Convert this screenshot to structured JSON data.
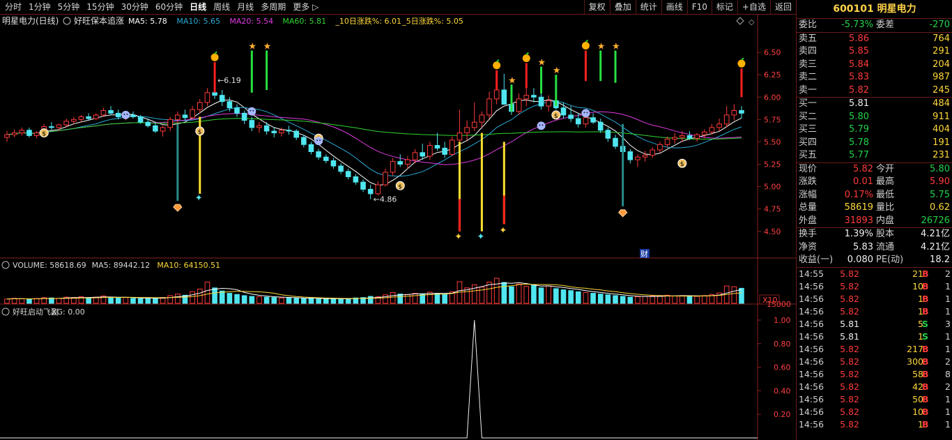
{
  "toolbar": {
    "periods": [
      "分时",
      "1分钟",
      "5分钟",
      "15分钟",
      "30分钟",
      "60分钟",
      "日线",
      "周线",
      "月线",
      "多周期",
      "更多"
    ],
    "active_period": "日线",
    "tools": [
      "复权",
      "叠加",
      "统计",
      "画线",
      "F10",
      "标记",
      "+自选",
      "返回"
    ]
  },
  "main_panel": {
    "stock_label": "明星电力(日线)",
    "indicator_name": "好旺保本追涨",
    "legend": [
      {
        "text": "MA5: 5.78",
        "color": "#ffffff"
      },
      {
        "text": "MA10: 5.65",
        "color": "#2aa9d6"
      },
      {
        "text": "MA20: 5.54",
        "color": "#e03be0"
      },
      {
        "text": "MA60: 5.81",
        "color": "#31d631"
      },
      {
        "text": "_10日涨跌%: 6.01",
        "color": "#ffd83a"
      },
      {
        "text": "_5日涨跌%: 5.05",
        "color": "#ffd83a"
      }
    ],
    "high_label": "6.19",
    "low_label": "4.86",
    "cai_label": "财",
    "y_ticks": [
      "6.50",
      "6.25",
      "6.00",
      "5.75",
      "5.50",
      "5.25",
      "5.00",
      "4.75",
      "4.50"
    ]
  },
  "volume_panel": {
    "legend": [
      {
        "text": "VOLUME: 58618.69",
        "color": "#d8d8d8"
      },
      {
        "text": "MA5: 89442.12",
        "color": "#d8d8d8"
      },
      {
        "text": "MA10: 64150.51",
        "color": "#ffd83a"
      }
    ],
    "y_tick": "15000",
    "unit": "X10"
  },
  "xg_panel": {
    "legend": [
      {
        "text": "好旺启动飞副",
        "color": "#d8d8d8"
      },
      {
        "text": "XG: 0.00",
        "color": "#d8d8d8"
      }
    ],
    "y_ticks": [
      "1.00",
      "0.80",
      "0.60",
      "0.40",
      "0.20"
    ]
  },
  "quote": {
    "header": "600101 明星电力",
    "weibi_label": "委比",
    "weibi": "-5.73%",
    "weicha_label": "委差",
    "weicha": "-270",
    "asks": [
      {
        "label": "卖五",
        "price": "5.86",
        "vol": "764"
      },
      {
        "label": "卖四",
        "price": "5.85",
        "vol": "291"
      },
      {
        "label": "卖三",
        "price": "5.84",
        "vol": "204"
      },
      {
        "label": "卖二",
        "price": "5.83",
        "vol": "987"
      },
      {
        "label": "卖一",
        "price": "5.82",
        "vol": "245"
      }
    ],
    "bids": [
      {
        "label": "买一",
        "price": "5.81",
        "vol": "484"
      },
      {
        "label": "买二",
        "price": "5.80",
        "vol": "911"
      },
      {
        "label": "买三",
        "price": "5.79",
        "vol": "404"
      },
      {
        "label": "买四",
        "price": "5.78",
        "vol": "191"
      },
      {
        "label": "买五",
        "price": "5.77",
        "vol": "231"
      }
    ],
    "stats": [
      {
        "l1": "现价",
        "v1": "5.82",
        "c1": "red",
        "l2": "今开",
        "v2": "5.80",
        "c2": "green"
      },
      {
        "l1": "涨跌",
        "v1": "0.01",
        "c1": "red",
        "l2": "最高",
        "v2": "5.90",
        "c2": "red"
      },
      {
        "l1": "涨幅",
        "v1": "0.17%",
        "c1": "red",
        "l2": "最低",
        "v2": "5.75",
        "c2": "green"
      },
      {
        "l1": "总量",
        "v1": "58619",
        "c1": "yellow",
        "l2": "量比",
        "v2": "0.62",
        "c2": "yellow"
      },
      {
        "l1": "外盘",
        "v1": "31893",
        "c1": "red",
        "l2": "内盘",
        "v2": "26726",
        "c2": "green"
      }
    ],
    "extra": [
      {
        "l1": "换手",
        "v1": "1.39%",
        "l2": "股本",
        "v2": "4.21亿"
      },
      {
        "l1": "净资",
        "v1": "5.83",
        "l2": "流通",
        "v2": "4.21亿"
      },
      {
        "l1": "收益(一)",
        "v1": "0.080",
        "l2": "PE(动)",
        "v2": "18.2"
      }
    ],
    "ticks": [
      {
        "time": "14:55",
        "price": "5.82",
        "vol": "21",
        "bs": "B",
        "n": "2"
      },
      {
        "time": "14:56",
        "price": "5.82",
        "vol": "10",
        "bs": "B",
        "n": "1"
      },
      {
        "time": "14:56",
        "price": "5.82",
        "vol": "1",
        "bs": "B",
        "n": "1"
      },
      {
        "time": "14:56",
        "price": "5.82",
        "vol": "1",
        "bs": "B",
        "n": "1"
      },
      {
        "time": "14:56",
        "price": "5.81",
        "vol": "5",
        "bs": "S",
        "n": "3"
      },
      {
        "time": "14:56",
        "price": "5.81",
        "vol": "1",
        "bs": "S",
        "n": "1"
      },
      {
        "time": "14:56",
        "price": "5.82",
        "vol": "217",
        "bs": "B",
        "n": "1"
      },
      {
        "time": "14:56",
        "price": "5.82",
        "vol": "300",
        "bs": "B",
        "n": "2"
      },
      {
        "time": "14:56",
        "price": "5.82",
        "vol": "58",
        "bs": "B",
        "n": "8"
      },
      {
        "time": "14:56",
        "price": "5.82",
        "vol": "42",
        "bs": "B",
        "n": "2"
      },
      {
        "time": "14:56",
        "price": "5.82",
        "vol": "50",
        "bs": "B",
        "n": "1"
      },
      {
        "time": "14:56",
        "price": "5.82",
        "vol": "10",
        "bs": "B",
        "n": "1"
      },
      {
        "time": "14:56",
        "price": "5.82",
        "vol": "1",
        "bs": "B",
        "n": "1"
      }
    ]
  },
  "chart_data": {
    "type": "candlestick",
    "ylim": [
      4.35,
      6.75
    ],
    "candles": [
      [
        5.55,
        5.62,
        5.5,
        5.58
      ],
      [
        5.58,
        5.64,
        5.55,
        5.6
      ],
      [
        5.6,
        5.66,
        5.57,
        5.63
      ],
      [
        5.63,
        5.66,
        5.55,
        5.57
      ],
      [
        5.57,
        5.62,
        5.54,
        5.6
      ],
      [
        5.6,
        5.7,
        5.58,
        5.67
      ],
      [
        5.67,
        5.72,
        5.63,
        5.66
      ],
      [
        5.66,
        5.7,
        5.62,
        5.69
      ],
      [
        5.69,
        5.76,
        5.66,
        5.73
      ],
      [
        5.73,
        5.78,
        5.7,
        5.75
      ],
      [
        5.75,
        5.8,
        5.72,
        5.78
      ],
      [
        5.78,
        5.82,
        5.74,
        5.76
      ],
      [
        5.76,
        5.82,
        5.74,
        5.8
      ],
      [
        5.8,
        5.88,
        5.78,
        5.85
      ],
      [
        5.85,
        5.9,
        5.8,
        5.82
      ],
      [
        5.82,
        5.86,
        5.75,
        5.78
      ],
      [
        5.78,
        5.83,
        5.74,
        5.8
      ],
      [
        5.8,
        5.84,
        5.76,
        5.78
      ],
      [
        5.78,
        5.8,
        5.7,
        5.72
      ],
      [
        5.72,
        5.76,
        5.66,
        5.68
      ],
      [
        5.68,
        5.72,
        5.6,
        5.62
      ],
      [
        5.62,
        5.68,
        5.56,
        5.66
      ],
      [
        5.66,
        5.78,
        5.62,
        5.75
      ],
      [
        5.75,
        5.84,
        5.7,
        5.8
      ],
      [
        5.8,
        5.86,
        5.74,
        5.77
      ],
      [
        5.77,
        5.9,
        5.75,
        5.86
      ],
      [
        5.86,
        5.98,
        5.82,
        5.94
      ],
      [
        5.94,
        6.1,
        5.9,
        6.05
      ],
      [
        6.05,
        6.19,
        5.98,
        6.02
      ],
      [
        6.02,
        6.08,
        5.9,
        5.95
      ],
      [
        5.95,
        6.0,
        5.84,
        5.88
      ],
      [
        5.88,
        5.92,
        5.78,
        5.82
      ],
      [
        5.82,
        5.85,
        5.7,
        5.74
      ],
      [
        5.74,
        5.78,
        5.62,
        5.66
      ],
      [
        5.66,
        5.72,
        5.6,
        5.68
      ],
      [
        5.68,
        5.72,
        5.58,
        5.62
      ],
      [
        5.62,
        5.66,
        5.55,
        5.6
      ],
      [
        5.6,
        5.66,
        5.56,
        5.63
      ],
      [
        5.63,
        5.68,
        5.58,
        5.62
      ],
      [
        5.62,
        5.64,
        5.52,
        5.55
      ],
      [
        5.55,
        5.58,
        5.44,
        5.47
      ],
      [
        5.47,
        5.5,
        5.36,
        5.39
      ],
      [
        5.39,
        5.42,
        5.3,
        5.33
      ],
      [
        5.33,
        5.36,
        5.26,
        5.29
      ],
      [
        5.29,
        5.32,
        5.2,
        5.23
      ],
      [
        5.23,
        5.26,
        5.14,
        5.17
      ],
      [
        5.17,
        5.2,
        5.08,
        5.11
      ],
      [
        5.11,
        5.14,
        5.02,
        5.05
      ],
      [
        5.05,
        5.08,
        4.94,
        4.97
      ],
      [
        4.97,
        5.02,
        4.86,
        4.92
      ],
      [
        4.92,
        5.06,
        4.9,
        5.02
      ],
      [
        5.02,
        5.2,
        5.0,
        5.16
      ],
      [
        5.16,
        5.32,
        5.12,
        5.28
      ],
      [
        5.28,
        5.36,
        5.22,
        5.25
      ],
      [
        5.25,
        5.34,
        5.2,
        5.3
      ],
      [
        5.3,
        5.42,
        5.26,
        5.38
      ],
      [
        5.38,
        5.48,
        5.3,
        5.34
      ],
      [
        5.34,
        5.5,
        5.3,
        5.46
      ],
      [
        5.46,
        5.6,
        5.4,
        5.43
      ],
      [
        5.43,
        5.5,
        5.32,
        5.36
      ],
      [
        5.36,
        5.56,
        5.34,
        5.52
      ],
      [
        5.52,
        5.86,
        5.48,
        5.6
      ],
      [
        5.6,
        5.74,
        5.52,
        5.66
      ],
      [
        5.66,
        5.94,
        5.62,
        5.72
      ],
      [
        5.72,
        5.84,
        5.66,
        5.8
      ],
      [
        5.8,
        6.06,
        5.76,
        5.98
      ],
      [
        5.98,
        6.2,
        5.92,
        6.08
      ],
      [
        6.08,
        6.26,
        6.0,
        5.92
      ],
      [
        5.92,
        6.0,
        5.8,
        5.84
      ],
      [
        5.84,
        6.04,
        5.8,
        5.98
      ],
      [
        5.98,
        6.18,
        5.9,
        6.02
      ],
      [
        6.02,
        6.1,
        5.94,
        6.0
      ],
      [
        6.0,
        6.06,
        5.86,
        5.9
      ],
      [
        5.9,
        6.02,
        5.84,
        5.96
      ],
      [
        5.96,
        6.04,
        5.86,
        5.88
      ],
      [
        5.88,
        5.94,
        5.76,
        5.8
      ],
      [
        5.8,
        5.9,
        5.72,
        5.76
      ],
      [
        5.76,
        5.82,
        5.66,
        5.7
      ],
      [
        5.7,
        5.8,
        5.66,
        5.77
      ],
      [
        5.77,
        5.82,
        5.7,
        5.72
      ],
      [
        5.72,
        5.76,
        5.6,
        5.63
      ],
      [
        5.63,
        5.66,
        5.5,
        5.54
      ],
      [
        5.54,
        5.58,
        5.42,
        5.45
      ],
      [
        5.45,
        5.5,
        5.36,
        5.39
      ],
      [
        5.39,
        5.42,
        5.26,
        5.3
      ],
      [
        5.3,
        5.36,
        5.22,
        5.33
      ],
      [
        5.33,
        5.4,
        5.28,
        5.35
      ],
      [
        5.35,
        5.44,
        5.32,
        5.41
      ],
      [
        5.41,
        5.5,
        5.38,
        5.47
      ],
      [
        5.47,
        5.56,
        5.44,
        5.53
      ],
      [
        5.53,
        5.6,
        5.48,
        5.55
      ],
      [
        5.55,
        5.62,
        5.5,
        5.57
      ],
      [
        5.57,
        5.62,
        5.52,
        5.54
      ],
      [
        5.54,
        5.6,
        5.5,
        5.58
      ],
      [
        5.58,
        5.64,
        5.54,
        5.61
      ],
      [
        5.61,
        5.7,
        5.58,
        5.66
      ],
      [
        5.66,
        5.76,
        5.62,
        5.7
      ],
      [
        5.7,
        5.9,
        5.66,
        5.8
      ],
      [
        5.8,
        5.92,
        5.74,
        5.85
      ],
      [
        5.85,
        5.9,
        5.76,
        5.82
      ]
    ],
    "volumes": [
      22,
      26,
      24,
      20,
      25,
      30,
      28,
      26,
      32,
      30,
      34,
      30,
      32,
      38,
      30,
      28,
      30,
      26,
      24,
      28,
      26,
      30,
      40,
      48,
      42,
      60,
      74,
      110,
      80,
      64,
      52,
      46,
      40,
      36,
      34,
      32,
      30,
      28,
      30,
      26,
      24,
      26,
      22,
      24,
      26,
      22,
      24,
      28,
      30,
      36,
      34,
      44,
      56,
      48,
      46,
      52,
      48,
      58,
      52,
      46,
      60,
      112,
      80,
      96,
      84,
      110,
      130,
      108,
      86,
      100,
      88,
      94,
      80,
      90,
      76,
      70,
      66,
      60,
      56,
      52,
      48,
      44,
      40,
      36,
      32,
      34,
      36,
      38,
      40,
      42,
      38,
      40,
      38,
      36,
      40,
      46,
      54,
      90,
      86,
      78
    ],
    "xg_spike_index": 63
  }
}
